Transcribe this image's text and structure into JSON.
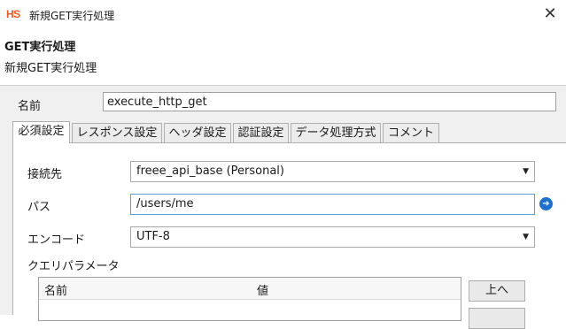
{
  "window": {
    "app_logo": "HS",
    "title": "新規GET実行処理",
    "close_glyph": "✕"
  },
  "header": {
    "title": "GET実行処理",
    "subtitle": "新規GET実行処理"
  },
  "name_field": {
    "label": "名前",
    "value": "execute_http_get"
  },
  "tabs": [
    {
      "label": "必須設定",
      "active": true
    },
    {
      "label": "レスポンス設定",
      "active": false
    },
    {
      "label": "ヘッダ設定",
      "active": false
    },
    {
      "label": "認証設定",
      "active": false
    },
    {
      "label": "データ処理方式",
      "active": false
    },
    {
      "label": "コメント",
      "active": false
    }
  ],
  "form": {
    "connection": {
      "label": "接続先",
      "value": "freee_api_base (Personal)"
    },
    "path": {
      "label": "パス",
      "value": "/users/me",
      "icon": "navigate-icon"
    },
    "encode": {
      "label": "エンコード",
      "value": "UTF-8"
    },
    "query_params": {
      "label": "クエリパラメータ",
      "columns": [
        "名前",
        "値"
      ],
      "up_button": "上へ"
    }
  },
  "colors": {
    "logo": "#f05a22",
    "focus_border": "#5b9bd5",
    "nav_icon": "#1f6fcf",
    "body_bg": "#f0f0f0"
  }
}
